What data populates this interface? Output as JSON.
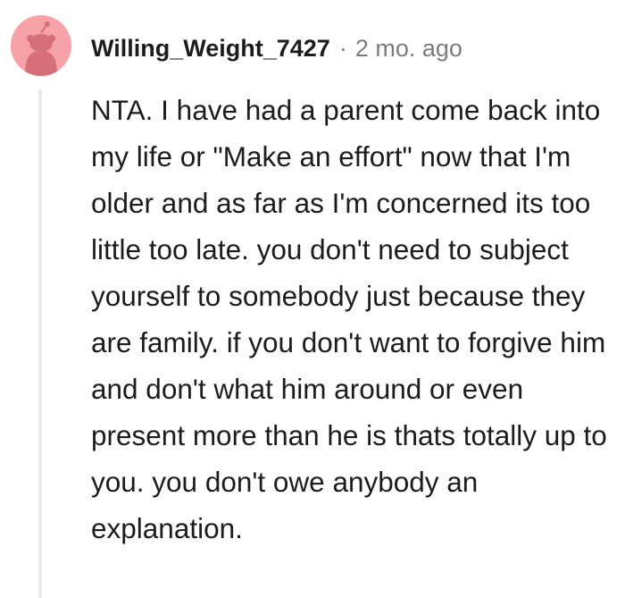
{
  "comment": {
    "author": "Willing_Weight_7427",
    "separator": "·",
    "timestamp": "2 mo. ago",
    "body": "NTA. I have had a parent come back into my life or \"Make an effort\" now that I'm older and as far as I'm concerned its too little too late. you don't need to subject yourself to somebody just because they are family. if you don't want to forgive him and don't what him around or even present more than he is thats totally up to you. you don't owe anybody an explanation.",
    "avatar_icon": "snoo-avatar-icon"
  },
  "colors": {
    "avatar_bg": "#f7a2a6",
    "avatar_figure": "#d56f78",
    "text": "#1c1c1c",
    "meta": "#7c7c7c",
    "thread_line": "#eaeaea"
  }
}
